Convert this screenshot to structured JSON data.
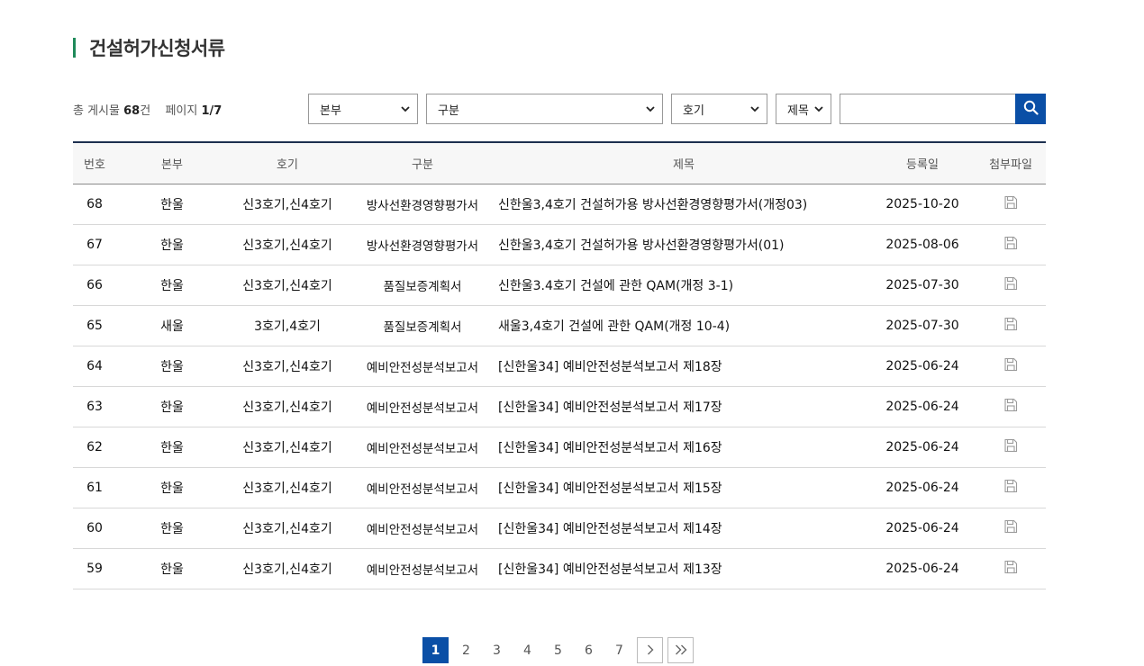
{
  "page": {
    "title": "건설허가신청서류"
  },
  "summary": {
    "total_prefix": "총 게시물",
    "total_count": "68",
    "total_suffix": "건",
    "page_prefix": "페이지",
    "page_value": "1/7"
  },
  "filters": {
    "bonbu": "본부",
    "gubun": "구분",
    "hogi": "호기",
    "field": "제목",
    "search_value": ""
  },
  "icons": {
    "search": "search-icon",
    "file": "save-disk-icon",
    "next": "chevron-right-icon",
    "last": "double-chevron-right-icon",
    "dropdown": "chevron-down-icon"
  },
  "colors": {
    "accent": "#0a4fa6",
    "title_bar": "#1f8a5a",
    "table_top": "#1c2f4f"
  },
  "table": {
    "headers": [
      "번호",
      "본부",
      "호기",
      "구분",
      "제목",
      "등록일",
      "첨부파일"
    ],
    "rows": [
      {
        "no": "68",
        "bonbu": "한울",
        "hogi": "신3호기,신4호기",
        "gubun": "방사선환경영향평가서",
        "title": "신한울3,4호기 건설허가용 방사선환경영향평가서(개정03)",
        "date": "2025-10-20"
      },
      {
        "no": "67",
        "bonbu": "한울",
        "hogi": "신3호기,신4호기",
        "gubun": "방사선환경영향평가서",
        "title": "신한울3,4호기 건설허가용 방사선환경영향평가서(01)",
        "date": "2025-08-06"
      },
      {
        "no": "66",
        "bonbu": "한울",
        "hogi": "신3호기,신4호기",
        "gubun": "품질보증계획서",
        "title": "신한울3.4호기 건설에 관한 QAM(개정 3-1)",
        "date": "2025-07-30"
      },
      {
        "no": "65",
        "bonbu": "새울",
        "hogi": "3호기,4호기",
        "gubun": "품질보증계획서",
        "title": "새울3,4호기 건설에 관한 QAM(개정 10-4)",
        "date": "2025-07-30"
      },
      {
        "no": "64",
        "bonbu": "한울",
        "hogi": "신3호기,신4호기",
        "gubun": "예비안전성분석보고서",
        "title": "[신한울34] 예비안전성분석보고서 제18장",
        "date": "2025-06-24"
      },
      {
        "no": "63",
        "bonbu": "한울",
        "hogi": "신3호기,신4호기",
        "gubun": "예비안전성분석보고서",
        "title": "[신한울34] 예비안전성분석보고서 제17장",
        "date": "2025-06-24"
      },
      {
        "no": "62",
        "bonbu": "한울",
        "hogi": "신3호기,신4호기",
        "gubun": "예비안전성분석보고서",
        "title": "[신한울34] 예비안전성분석보고서 제16장",
        "date": "2025-06-24"
      },
      {
        "no": "61",
        "bonbu": "한울",
        "hogi": "신3호기,신4호기",
        "gubun": "예비안전성분석보고서",
        "title": "[신한울34] 예비안전성분석보고서 제15장",
        "date": "2025-06-24"
      },
      {
        "no": "60",
        "bonbu": "한울",
        "hogi": "신3호기,신4호기",
        "gubun": "예비안전성분석보고서",
        "title": "[신한울34] 예비안전성분석보고서 제14장",
        "date": "2025-06-24"
      },
      {
        "no": "59",
        "bonbu": "한울",
        "hogi": "신3호기,신4호기",
        "gubun": "예비안전성분석보고서",
        "title": "[신한울34] 예비안전성분석보고서 제13장",
        "date": "2025-06-24"
      }
    ]
  },
  "pagination": {
    "pages": [
      "1",
      "2",
      "3",
      "4",
      "5",
      "6",
      "7"
    ],
    "current": "1"
  }
}
